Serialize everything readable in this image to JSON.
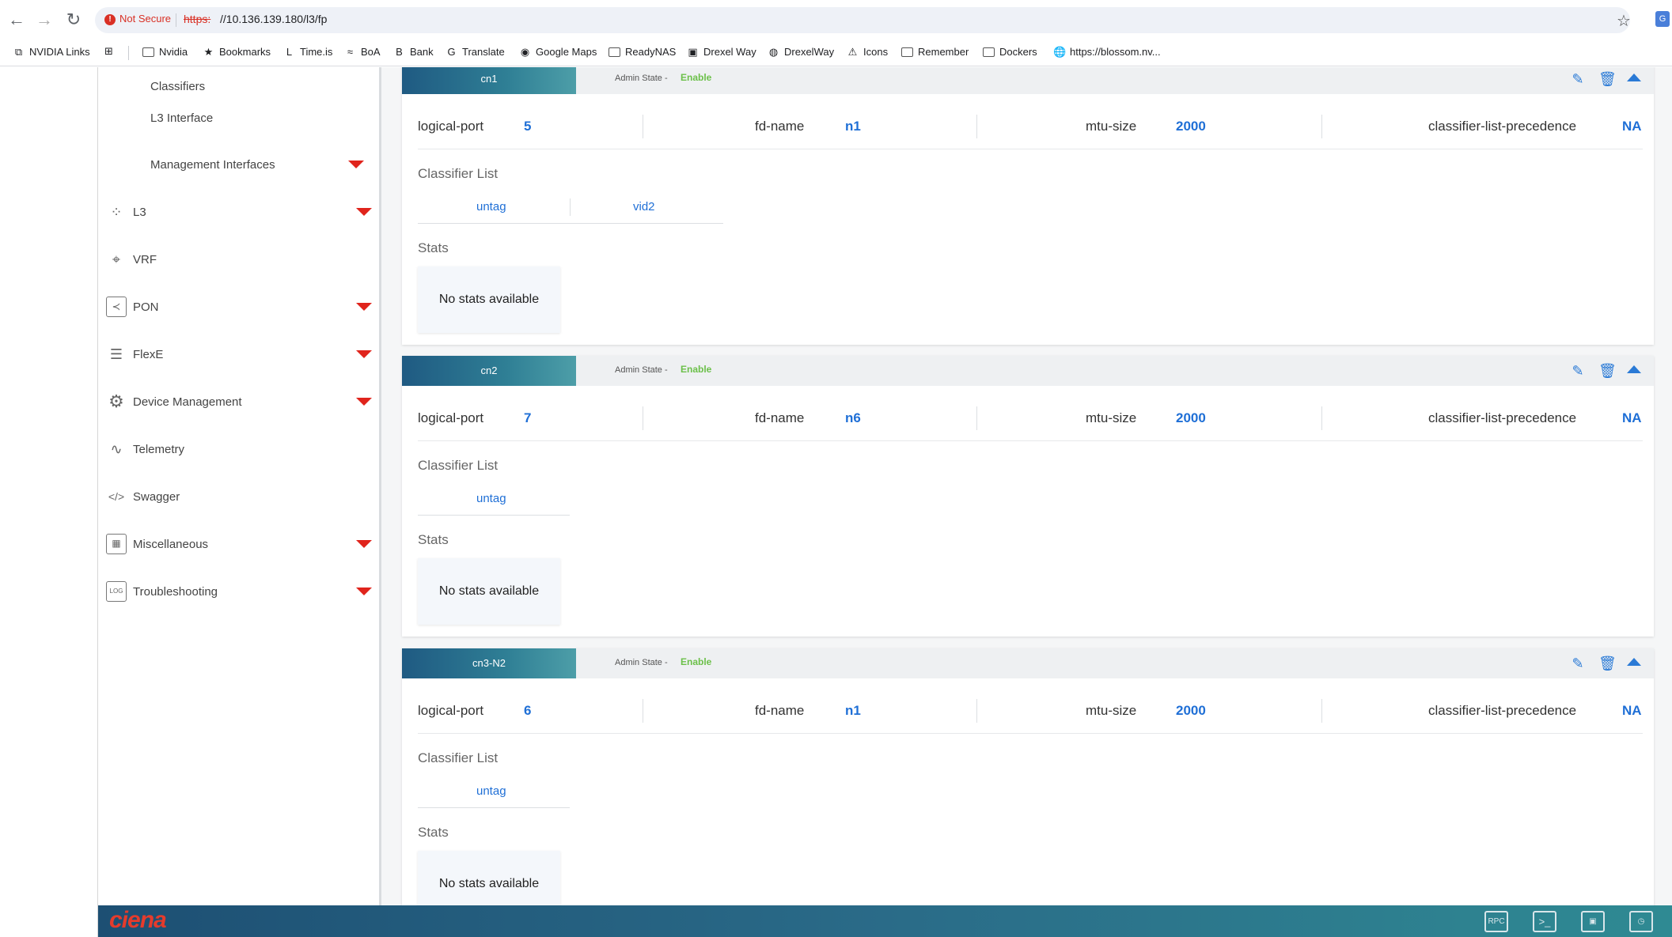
{
  "browser": {
    "security_label": "Not Secure",
    "url_scheme": "https:",
    "url_rest": "//10.136.139.180/l3/fp",
    "bookmarks": [
      "NVIDIA Links",
      "Nvidia",
      "Bookmarks",
      "Time.is",
      "BoA",
      "Bank",
      "Translate",
      "Google Maps",
      "ReadyNAS",
      "Drexel Way",
      "DrexelWay",
      "Icons",
      "Remember",
      "Dockers",
      "https://blossom.nv..."
    ]
  },
  "sidebar": {
    "sub_items": [
      "Classifiers",
      "L3 Interface",
      "Management Interfaces"
    ],
    "items": [
      {
        "label": "L3",
        "icon": "l3-network-icon"
      },
      {
        "label": "VRF",
        "icon": "vrf-icon"
      },
      {
        "label": "PON",
        "icon": "pon-icon"
      },
      {
        "label": "FlexE",
        "icon": "flexe-icon"
      },
      {
        "label": "Device Management",
        "icon": "gear-icon"
      },
      {
        "label": "Telemetry",
        "icon": "telemetry-icon"
      },
      {
        "label": "Swagger",
        "icon": "code-icon"
      },
      {
        "label": "Miscellaneous",
        "icon": "misc-icon"
      },
      {
        "label": "Troubleshooting",
        "icon": "log-icon"
      }
    ]
  },
  "labels": {
    "admin_state": "Admin State -",
    "logical_port": "logical-port",
    "fd_name": "fd-name",
    "mtu_size": "mtu-size",
    "classifier_precedence": "classifier-list-precedence",
    "classifier_list": "Classifier List",
    "stats": "Stats",
    "no_stats": "No stats available"
  },
  "cards": [
    {
      "name": "cn1",
      "admin_state": "Enable",
      "logical_port": "5",
      "fd_name": "n1",
      "mtu_size": "2000",
      "precedence": "NA",
      "classifiers": [
        "untag",
        "vid2"
      ]
    },
    {
      "name": "cn2",
      "admin_state": "Enable",
      "logical_port": "7",
      "fd_name": "n6",
      "mtu_size": "2000",
      "precedence": "NA",
      "classifiers": [
        "untag"
      ]
    },
    {
      "name": "cn3-N2",
      "admin_state": "Enable",
      "logical_port": "6",
      "fd_name": "n1",
      "mtu_size": "2000",
      "precedence": "NA",
      "classifiers": [
        "untag"
      ]
    }
  ],
  "footer": {
    "logo": "ciena",
    "buttons": [
      "RPC",
      ">_",
      "",
      ""
    ]
  },
  "colors": {
    "accent": "#1f6fd6",
    "enable": "#6cc04a",
    "caret": "#e0241c"
  }
}
